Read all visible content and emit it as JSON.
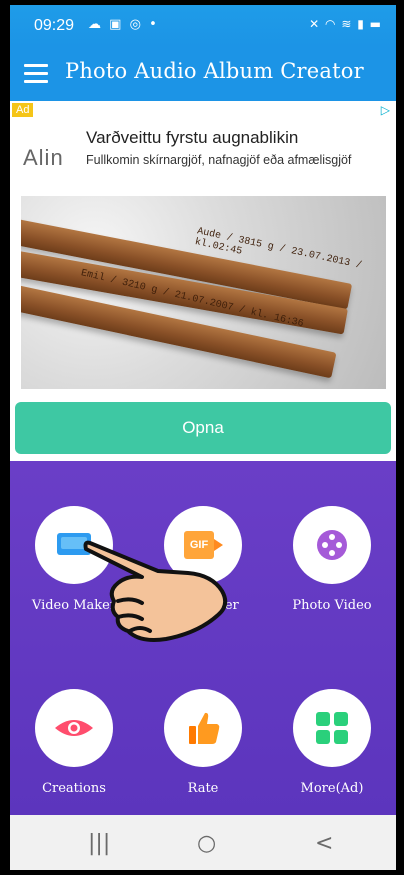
{
  "status_bar": {
    "time": "09:29",
    "notification_icons": [
      "cloud-icon",
      "gallery-icon",
      "at-icon",
      "dot-icon"
    ],
    "system_icons": [
      "mute-icon",
      "wifi-icon",
      "volte-icon",
      "signal-icon",
      "battery-icon"
    ]
  },
  "header": {
    "title": "Photo Audio Album Creator",
    "menu_icon": "hamburger-menu-icon"
  },
  "ad": {
    "badge": "Ad",
    "brand": "Alin",
    "headline": "Varðveittu fyrstu augnablikin",
    "subline": "Fullkomin skírnargjöf, nafnagjöf eða afmælisgjöf",
    "image_labels": [
      "Aude / 3815 g / 23.07.2013 / kl.02:45",
      "Emil / 3210 g / 21.07.2007 / kl. 16:36"
    ],
    "cta": "Opna",
    "cta_color": "#3ec8a3"
  },
  "tiles": [
    {
      "label": "Video Maker",
      "icon": "video-icon"
    },
    {
      "label": "GIF Maker",
      "icon": "gif-camera-icon"
    },
    {
      "label": "Photo Video",
      "icon": "film-reel-icon"
    },
    {
      "label": "Creations",
      "icon": "eye-icon"
    },
    {
      "label": "Rate",
      "icon": "thumbs-up-icon"
    },
    {
      "label": "More(Ad)",
      "icon": "apps-grid-icon"
    }
  ],
  "nav": {
    "recents": "|||",
    "home": "○",
    "back": "<"
  },
  "colors": {
    "header": "#1c94e6",
    "main_bg": "#6a3ec7"
  }
}
